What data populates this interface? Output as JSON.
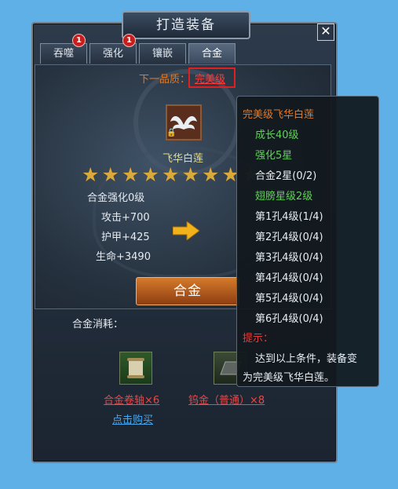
{
  "window": {
    "title": "打造装备",
    "close_icon": "✕"
  },
  "tabs": [
    {
      "label": "吞噬",
      "badge": "1",
      "active": false
    },
    {
      "label": "强化",
      "badge": "1",
      "active": false
    },
    {
      "label": "镶嵌",
      "badge": "",
      "active": false
    },
    {
      "label": "合金",
      "badge": "",
      "active": true
    }
  ],
  "quality": {
    "label": "下一品质：",
    "value": "完美级"
  },
  "item": {
    "name": "飞华白莲",
    "stars_total": 10,
    "stars_filled": 8,
    "lock_icon": "🔒"
  },
  "stats": {
    "level": "合金强化0级",
    "attack": "攻击+700",
    "armor": "护甲+425",
    "hp": "生命+3490"
  },
  "action_button": "合金",
  "cost": {
    "label": "合金消耗：",
    "materials": [
      {
        "name": "合金卷轴×6",
        "icon": "scroll-icon"
      },
      {
        "name": "钨金（普通）×8",
        "icon": "tungsten-icon"
      }
    ],
    "buy_link": "点击购买"
  },
  "tooltip": {
    "title": "完美级飞华白莲",
    "requirements": [
      {
        "text": "成长40级",
        "met": true
      },
      {
        "text": "强化5星",
        "met": true
      },
      {
        "text": "合金2星(0/2)",
        "met": false
      },
      {
        "text": "翅膀星级2级",
        "met": true
      },
      {
        "text": "第1孔4级(1/4)",
        "met": false
      },
      {
        "text": "第2孔4级(0/4)",
        "met": false
      },
      {
        "text": "第3孔4级(0/4)",
        "met": false
      },
      {
        "text": "第4孔4级(0/4)",
        "met": false
      },
      {
        "text": "第5孔4级(0/4)",
        "met": false
      },
      {
        "text": "第6孔4级(0/4)",
        "met": false
      }
    ],
    "hint_label": "提示：",
    "hint_line1": "达到以上条件，装备变",
    "hint_line2": "为完美级飞华白莲。"
  },
  "colors": {
    "orange": "#e07a2a",
    "green": "#62d05a",
    "white": "#e8edf3",
    "red": "#e83a3a"
  }
}
